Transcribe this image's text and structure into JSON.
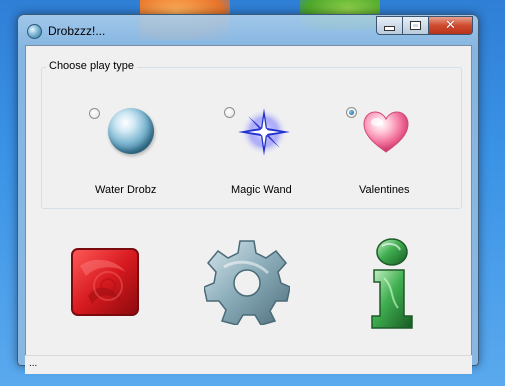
{
  "window": {
    "title": "Drobzzz!..."
  },
  "group": {
    "title": "Choose play type",
    "options": [
      {
        "label": "Water Drobz",
        "checked": false,
        "icon": "water-drop-orb-icon"
      },
      {
        "label": "Magic Wand",
        "checked": false,
        "icon": "magic-star-icon"
      },
      {
        "label": "Valentines",
        "checked": true,
        "icon": "heart-icon"
      }
    ]
  },
  "actions": [
    {
      "name": "play",
      "icon": "red-square-tile-icon"
    },
    {
      "name": "settings",
      "icon": "gear-icon"
    },
    {
      "name": "info",
      "icon": "info-letter-icon"
    }
  ],
  "status": {
    "text": "..."
  },
  "colors": {
    "title_bar": "#8cb9e1",
    "client_bg": "#f0f0f0",
    "close_button": "#c7442a",
    "radio_dot": "#1b5a8c",
    "tile_red": "#c8161a",
    "gear_steel": "#8fb0bd",
    "info_green": "#3a9a4a"
  }
}
